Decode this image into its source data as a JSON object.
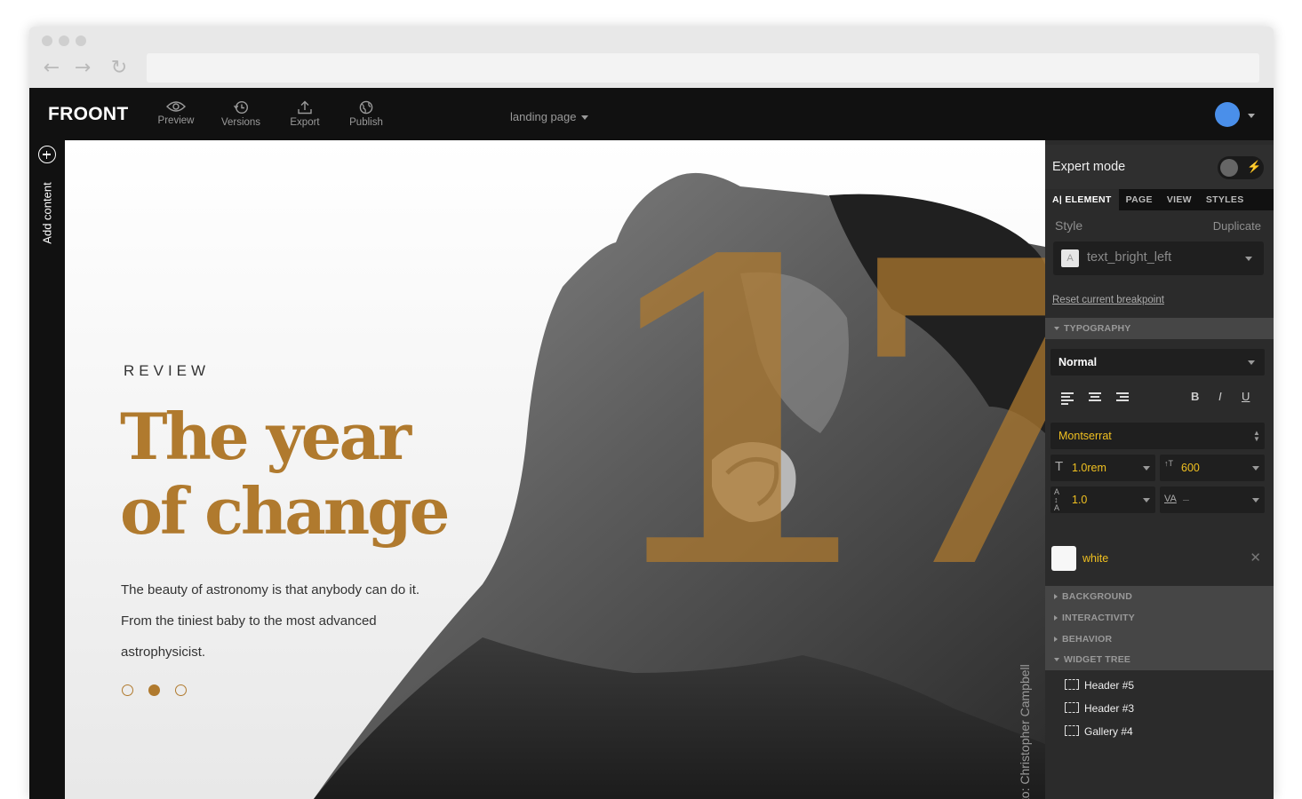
{
  "app": {
    "logo": "FROONT",
    "toolbar": [
      {
        "label": "Preview",
        "icon": "eye-icon"
      },
      {
        "label": "Versions",
        "icon": "history-icon"
      },
      {
        "label": "Export",
        "icon": "upload-icon"
      },
      {
        "label": "Publish",
        "icon": "globe-icon"
      }
    ],
    "page_selector": "landing page",
    "avatar_color": "#4a8fea"
  },
  "rail": {
    "add_content_label": "Add content"
  },
  "canvas": {
    "big_number": "17",
    "eyebrow": "REVIEW",
    "headline_line1": "The year",
    "headline_line2": "of change",
    "body_line1": "The beauty of astronomy is that anybody can do it.",
    "body_line2": "From the tiniest baby to the most advanced",
    "body_line3": "astrophysicist.",
    "slider_total": 3,
    "slider_active": 2,
    "credit": "Photo: Christopher Campbell",
    "accent_color": "#b07a2e"
  },
  "panel": {
    "expert_mode_label": "Expert mode",
    "expert_mode_on": false,
    "tabs": [
      "ELEMENT",
      "PAGE",
      "VIEW",
      "STYLES"
    ],
    "active_tab": "ELEMENT",
    "tab_prefix": "A|",
    "style_label": "Style",
    "duplicate_label": "Duplicate",
    "style_value": "text_bright_left",
    "reset_label": "Reset current breakpoint",
    "typography_label": "TYPOGRAPHY",
    "text_style": "Normal",
    "format": {
      "bold": "B",
      "italic": "I",
      "underline": "U"
    },
    "font_family": "Montserrat",
    "font_size": "1.0rem",
    "font_weight": "600",
    "line_height": "1.0",
    "letter_spacing_label": "VA",
    "letter_spacing_value": "–",
    "color_name": "white",
    "sections": [
      "BACKGROUND",
      "INTERACTIVITY",
      "BEHAVIOR"
    ],
    "widget_tree_label": "WIDGET TREE",
    "tree_items": [
      "Header #5",
      "Header #3",
      "Gallery #4"
    ],
    "value_color": "#f0c020"
  }
}
